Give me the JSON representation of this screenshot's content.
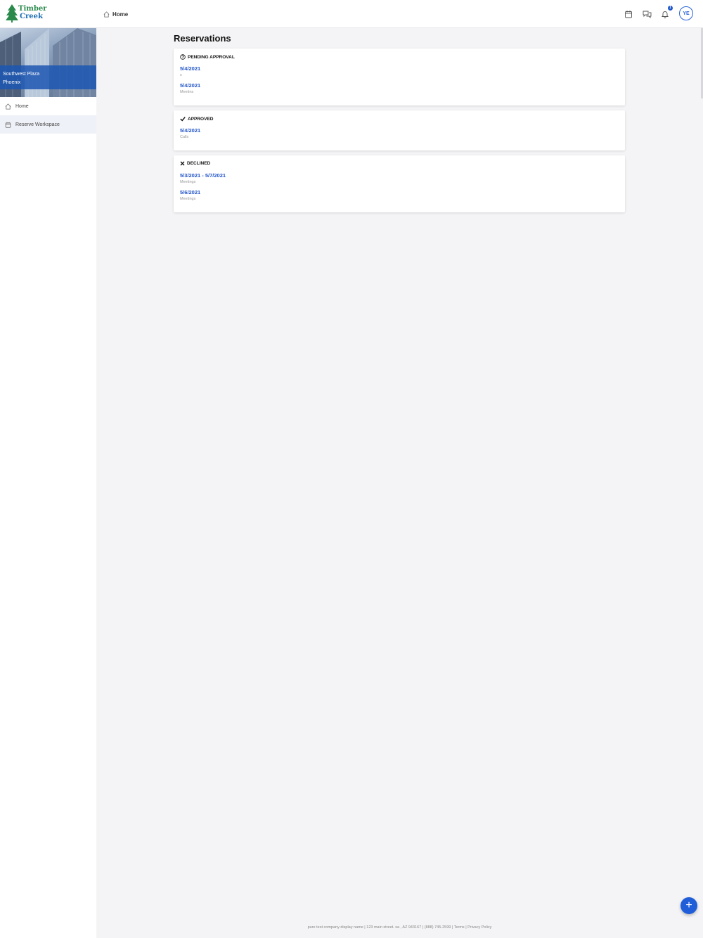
{
  "brand": {
    "line1": "Timber",
    "line2": "Creek"
  },
  "header": {
    "breadcrumb": "Home",
    "notification_count": "1",
    "avatar_initials": "YE"
  },
  "sidebar": {
    "location_name": "Southwest Plaza",
    "location_city": "Phoenix",
    "items": [
      {
        "label": "Home",
        "icon": "home-icon"
      },
      {
        "label": "Reserve Workspace",
        "icon": "calendar-icon"
      }
    ]
  },
  "page": {
    "title": "Reservations"
  },
  "sections": {
    "pending": {
      "label": "PENDING APPROVAL",
      "items": [
        {
          "date": "5/4/2021",
          "type": "s"
        },
        {
          "date": "5/4/2021",
          "type": "Meetins"
        }
      ]
    },
    "approved": {
      "label": "APPROVED",
      "items": [
        {
          "date": "5/4/2021",
          "type": "Calls"
        }
      ]
    },
    "declined": {
      "label": "DECLINED",
      "items": [
        {
          "date": "5/3/2021 - 5/7/2021",
          "type": "Meetings"
        },
        {
          "date": "5/6/2021",
          "type": "Meetings"
        }
      ]
    }
  },
  "footer": {
    "text": "pure test company display name | 123 main street. sa , AZ 943167 | (888) 745-2599 | Terms | Privacy Policy"
  },
  "fab": {
    "label": "+"
  },
  "colors": {
    "accent": "#2456c9",
    "brand_green": "#2a8a4c"
  }
}
